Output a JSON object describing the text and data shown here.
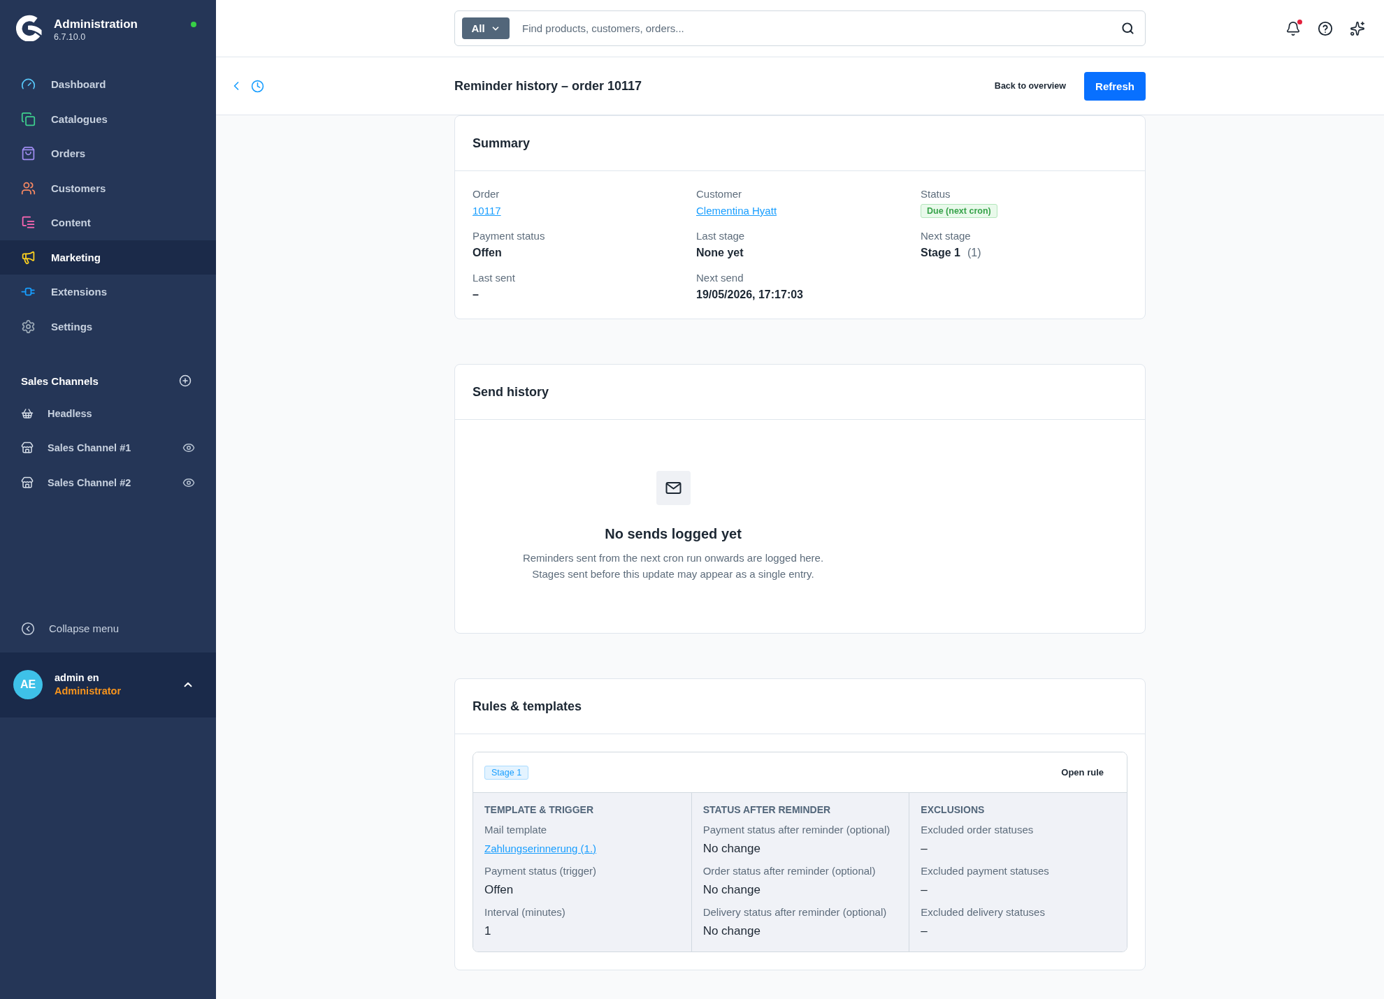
{
  "sidebar": {
    "app": {
      "title": "Administration",
      "version": "6.7.10.0",
      "online": true
    },
    "nav_items": [
      {
        "label": "Dashboard",
        "selected": false
      },
      {
        "label": "Catalogues",
        "selected": false
      },
      {
        "label": "Orders",
        "selected": false
      },
      {
        "label": "Customers",
        "selected": false
      },
      {
        "label": "Content",
        "selected": false
      },
      {
        "label": "Marketing",
        "selected": true
      },
      {
        "label": "Extensions",
        "selected": false
      },
      {
        "label": "Settings",
        "selected": false
      }
    ],
    "sales_channels": {
      "title": "Sales Channels",
      "items": [
        {
          "label": "Headless",
          "kind": "headless"
        },
        {
          "label": "Sales Channel #1",
          "kind": "storefront"
        },
        {
          "label": "Sales Channel #2",
          "kind": "storefront"
        }
      ]
    },
    "collapse_label": "Collapse menu",
    "user": {
      "initials": "AE",
      "name": "admin en",
      "role": "Administrator"
    }
  },
  "top_bar": {
    "search": {
      "scope": "All",
      "placeholder": "Find products, customers, orders..."
    },
    "unread_notifications": true
  },
  "page_header": {
    "title": "Reminder history – order 10117",
    "back_link": "Back to overview",
    "refresh_button": "Refresh"
  },
  "summary": {
    "title": "Summary",
    "fields": [
      {
        "label": "Order",
        "kind": "link",
        "value": "10117"
      },
      {
        "label": "Customer",
        "kind": "link",
        "value": "Clementina Hyatt"
      },
      {
        "label": "Status",
        "kind": "badge",
        "value": "Due (next cron)"
      },
      {
        "label": "Payment status",
        "kind": "text",
        "value": "Offen"
      },
      {
        "label": "Last stage",
        "kind": "text",
        "value": "None yet"
      },
      {
        "label": "Next stage",
        "kind": "text",
        "value": "Stage 1",
        "note": "(1)"
      },
      {
        "label": "Last sent",
        "kind": "text",
        "value": "–"
      },
      {
        "label": "Next send",
        "kind": "text",
        "value": "19/05/2026, 17:17:03"
      }
    ]
  },
  "send_history": {
    "title": "Send history",
    "empty_state": {
      "title": "No sends logged yet",
      "lines": [
        "Reminders sent from the next cron run onwards are logged here.",
        "Stages sent before this update may appear as a single entry."
      ]
    }
  },
  "rules": {
    "title": "Rules & templates",
    "stages": [
      {
        "badge": "Stage 1",
        "open_button": "Open rule",
        "columns": [
          {
            "heading": "TEMPLATE & TRIGGER",
            "fields": [
              {
                "label": "Mail template",
                "kind": "link",
                "value": "Zahlungserinnerung (1.)"
              },
              {
                "label": "Payment status (trigger)",
                "kind": "text",
                "value": "Offen"
              },
              {
                "label": "Interval (minutes)",
                "kind": "text",
                "value": "1"
              }
            ]
          },
          {
            "heading": "STATUS AFTER REMINDER",
            "fields": [
              {
                "label": "Payment status after reminder (optional)",
                "kind": "text",
                "value": "No change"
              },
              {
                "label": "Order status after reminder (optional)",
                "kind": "text",
                "value": "No change"
              },
              {
                "label": "Delivery status after reminder (optional)",
                "kind": "text",
                "value": "No change"
              }
            ]
          },
          {
            "heading": "EXCLUSIONS",
            "fields": [
              {
                "label": "Excluded order statuses",
                "kind": "text",
                "value": "–"
              },
              {
                "label": "Excluded payment statuses",
                "kind": "text",
                "value": "–"
              },
              {
                "label": "Excluded delivery statuses",
                "kind": "text",
                "value": "–"
              }
            ]
          }
        ]
      }
    ]
  }
}
